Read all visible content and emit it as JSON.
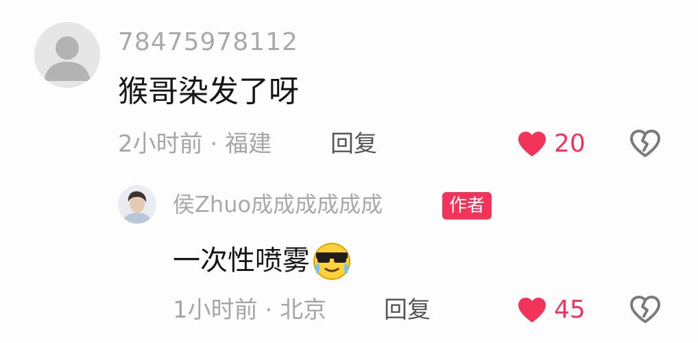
{
  "comment": {
    "username": "78475978112",
    "text": "猴哥染发了呀",
    "time": "2小时前",
    "separator": " · ",
    "location": "福建",
    "reply_label": "回复",
    "like_count": "20",
    "like_color": "#f2345a",
    "avatar_icon": "default-user-avatar",
    "dislike_icon": "broken-heart-icon"
  },
  "reply": {
    "username": "侯Zhuo成成成成成成",
    "badge": "作者",
    "badge_color": "#f2345a",
    "text": "一次性喷雾",
    "emoji_icon": "cool-sunglasses-tears-emoji",
    "time": "1小时前",
    "separator": " · ",
    "location": "北京",
    "reply_label": "回复",
    "like_count": "45",
    "like_color": "#f2345a",
    "avatar_icon": "user-photo-avatar",
    "dislike_icon": "broken-heart-icon"
  }
}
